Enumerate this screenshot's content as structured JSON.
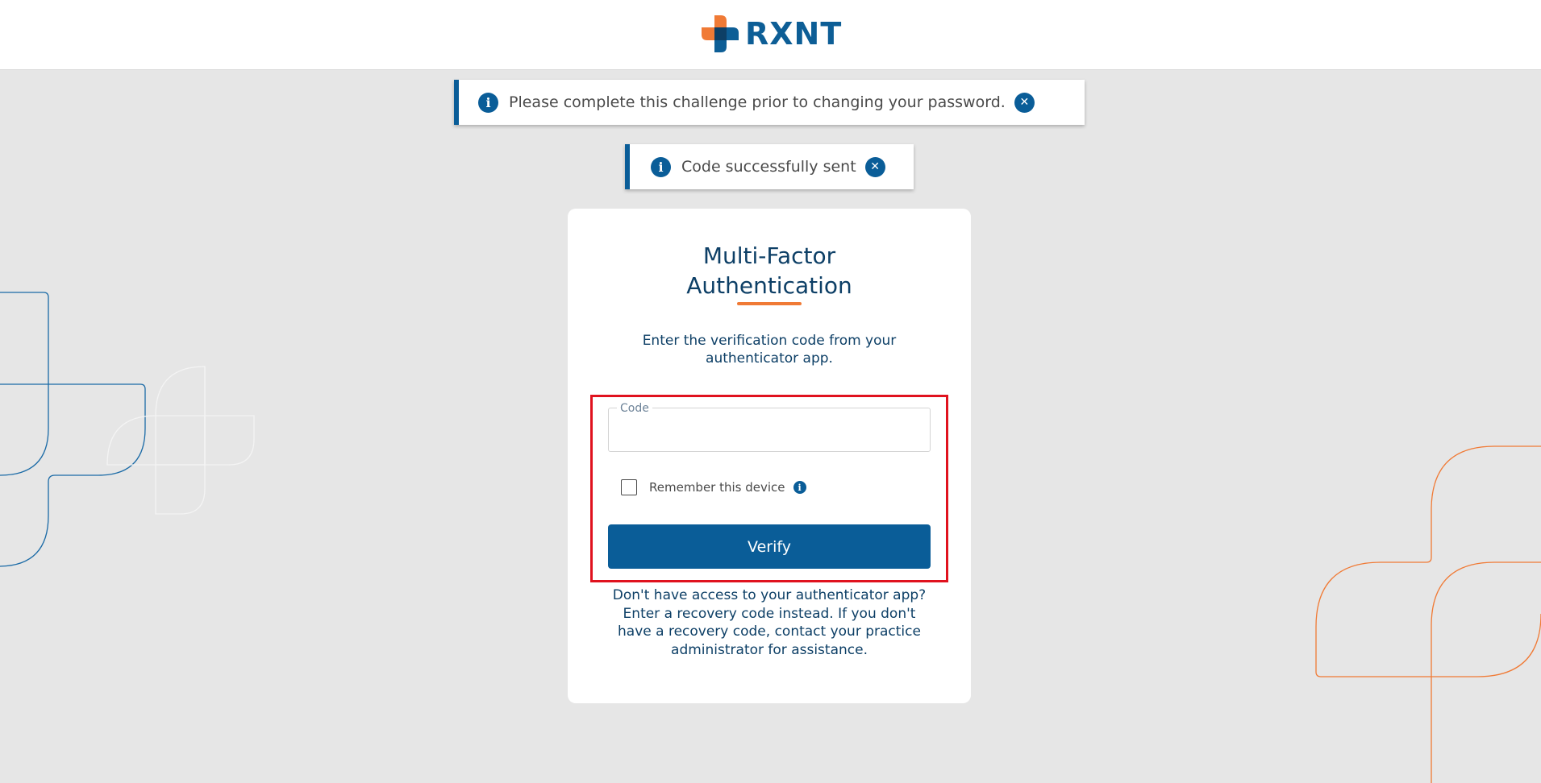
{
  "header": {
    "brand_name": "RXNT",
    "logo_colors": {
      "orange": "#f07a35",
      "blue": "#0d5e96",
      "dark": "#0d3f66"
    }
  },
  "notifications": [
    {
      "icon": "info-icon",
      "text": "Please complete this challenge prior to changing your password.",
      "close_icon": "close-icon"
    },
    {
      "icon": "info-icon",
      "text": "Code successfully sent",
      "close_icon": "close-icon"
    }
  ],
  "mfa": {
    "title_line1": "Multi-Factor",
    "title_line2": "Authentication",
    "subtitle": "Enter the verification code from your authenticator app.",
    "code_label": "Code",
    "code_value": "",
    "remember_label": "Remember this device",
    "remember_checked": false,
    "verify_label": "Verify",
    "recovery_text": "Don't have access to your authenticator app? Enter a recovery code instead. If you don't have a recovery code, contact your practice administrator for assistance."
  },
  "colors": {
    "accent_blue": "#0a5d98",
    "accent_orange": "#f07a35",
    "highlight_red": "#e0121e",
    "background": "#e6e6e6"
  }
}
